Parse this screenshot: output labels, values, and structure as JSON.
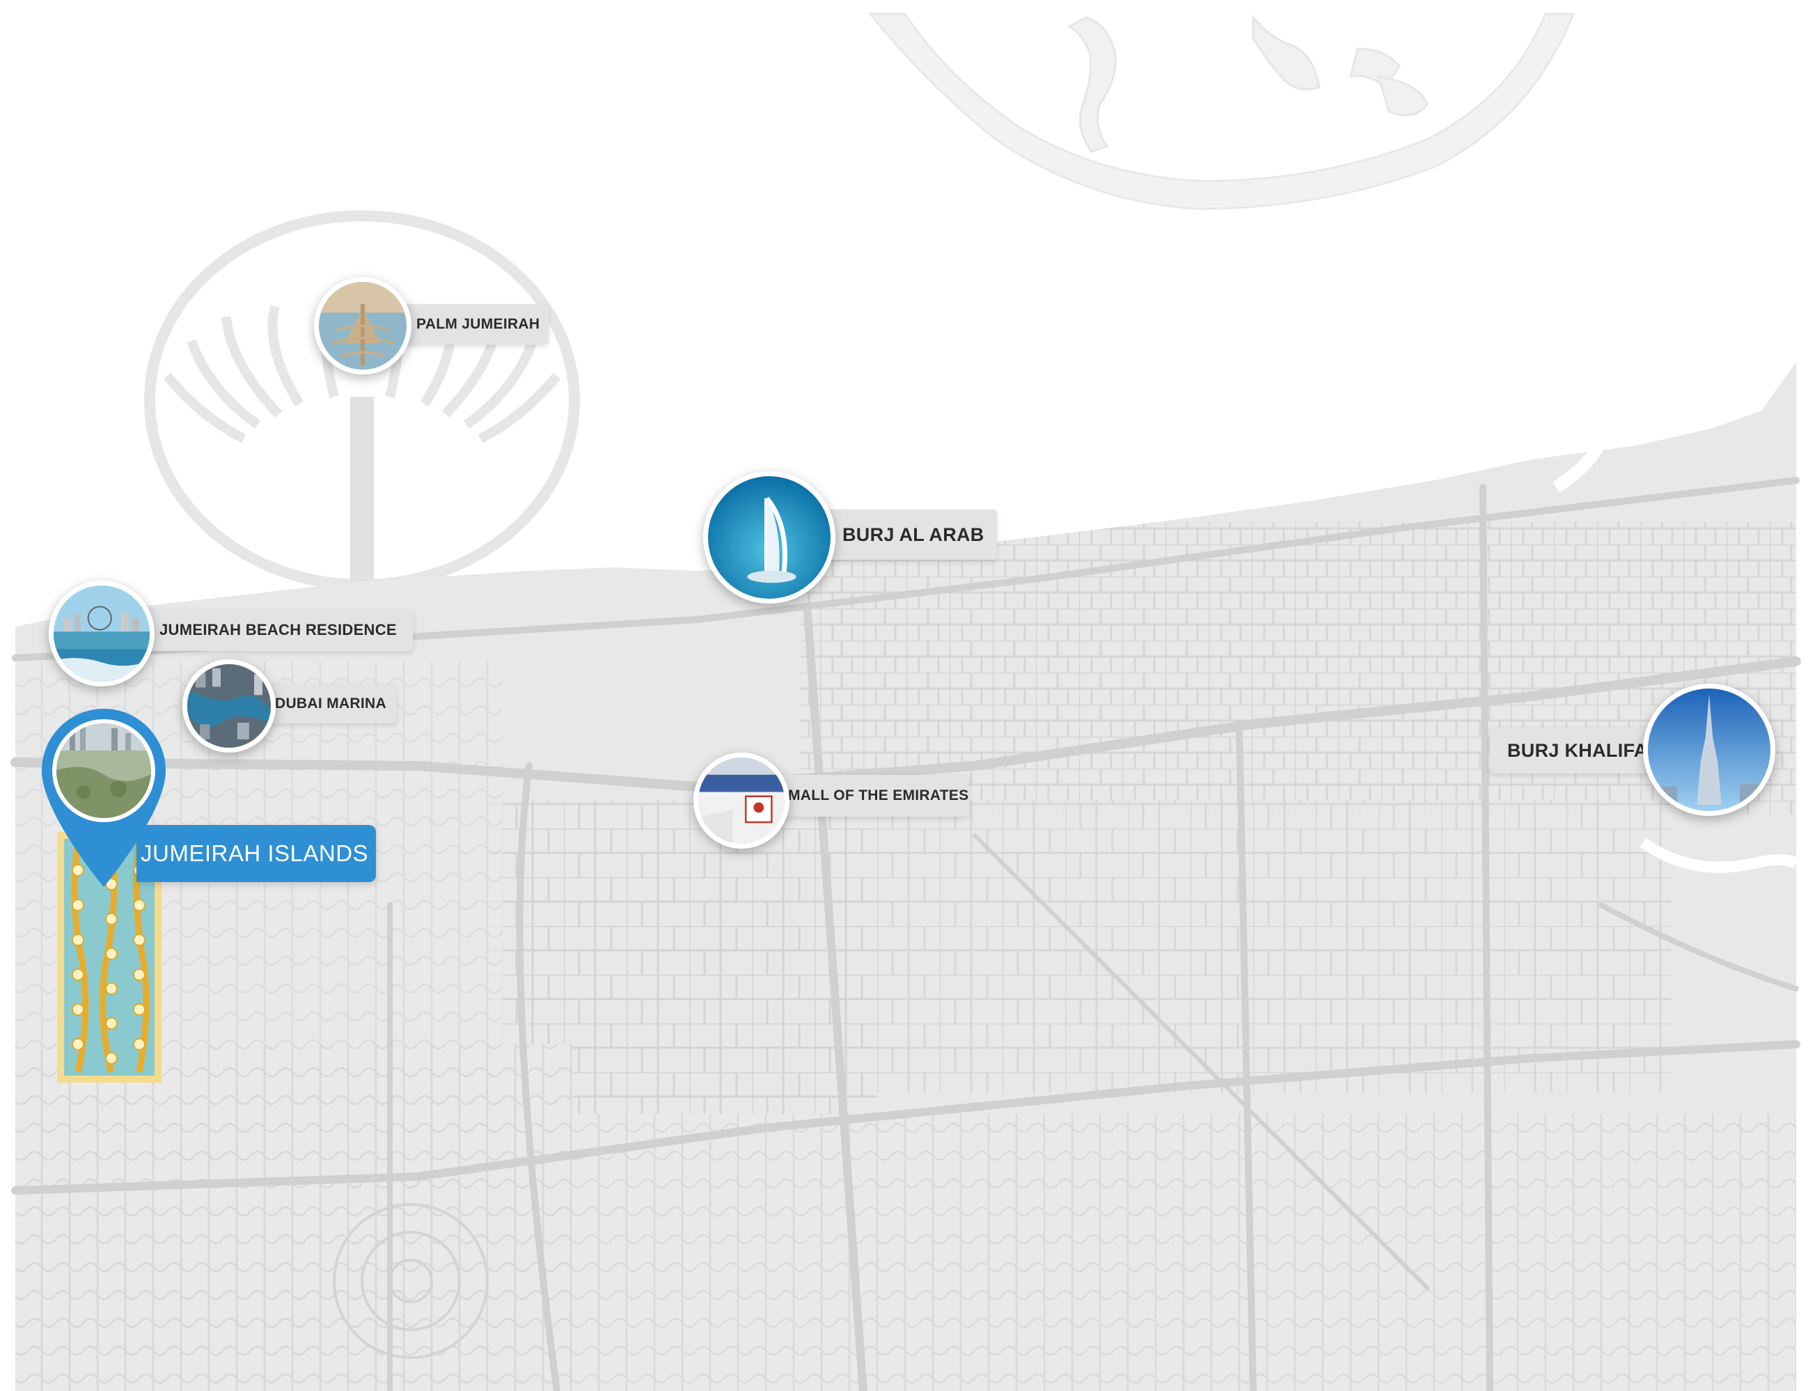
{
  "map": {
    "colors": {
      "land": "#e8e8e8",
      "roads": "#d2d2d2",
      "water": "#ffffff",
      "label_bg": "#e3e3e3",
      "label_text": "#2b2b2b",
      "accent": "#2e8fd4"
    },
    "selected_location": {
      "label": "JUMEIRAH ISLANDS",
      "icon": "map-pin-icon"
    },
    "landmarks": [
      {
        "id": "palm-jumeirah",
        "label": "PALM JUMEIRAH",
        "icon": "palm-photo"
      },
      {
        "id": "burj-al-arab",
        "label": "BURJ AL ARAB",
        "icon": "burj-al-arab-photo"
      },
      {
        "id": "jumeirah-beach-residence",
        "label": "JUMEIRAH BEACH RESIDENCE",
        "icon": "beach-photo"
      },
      {
        "id": "dubai-marina",
        "label": "DUBAI MARINA",
        "icon": "marina-photo"
      },
      {
        "id": "mall-of-the-emirates",
        "label": "MALL OF THE EMIRATES",
        "icon": "mall-photo"
      },
      {
        "id": "burj-khalifa",
        "label": "BURJ KHALIFA",
        "icon": "burj-khalifa-photo"
      }
    ]
  }
}
